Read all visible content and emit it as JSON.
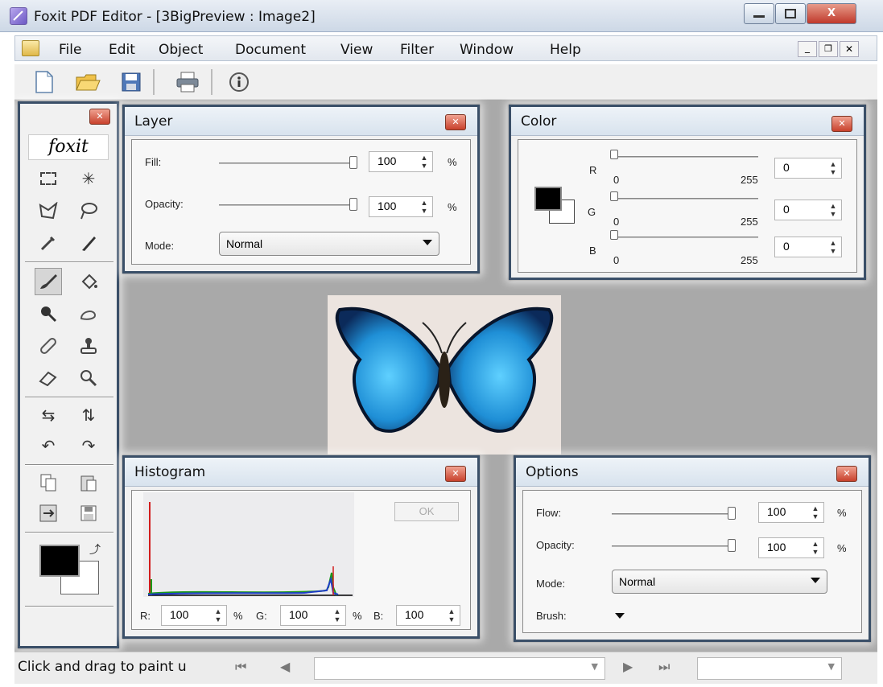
{
  "window": {
    "title": "Foxit PDF Editor - [3BigPreview : Image2]",
    "close_label": "X"
  },
  "menu": {
    "items": [
      "File",
      "Edit",
      "Object",
      "Document",
      "View",
      "Filter",
      "Window",
      "Help"
    ]
  },
  "toolbox": {
    "brand": "foxit"
  },
  "layer": {
    "title": "Layer",
    "fill_label": "Fill:",
    "fill_value": "100",
    "fill_pct": 1.0,
    "opacity_label": "Opacity:",
    "opacity_value": "100",
    "opacity_pct": 1.0,
    "mode_label": "Mode:",
    "mode_value": "Normal",
    "unit": "%"
  },
  "color": {
    "title": "Color",
    "channels": [
      {
        "label": "R",
        "min": "0",
        "max": "255",
        "value": "0"
      },
      {
        "label": "G",
        "min": "0",
        "max": "255",
        "value": "0"
      },
      {
        "label": "B",
        "min": "0",
        "max": "255",
        "value": "0"
      }
    ],
    "foreground": "#000000",
    "background": "#ffffff"
  },
  "histogram": {
    "title": "Histogram",
    "ok_label": "OK",
    "r_label": "R:",
    "r_value": "100",
    "g_label": "G:",
    "g_value": "100",
    "b_label": "B:",
    "b_value": "100",
    "unit": "%"
  },
  "options": {
    "title": "Options",
    "flow_label": "Flow:",
    "flow_value": "100",
    "flow_pct": 1.0,
    "opacity_label": "Opacity:",
    "opacity_value": "100",
    "opacity_pct": 1.0,
    "mode_label": "Mode:",
    "mode_value": "Normal",
    "brush_label": "Brush:",
    "unit": "%"
  },
  "status": {
    "text": "Click and drag to paint u"
  },
  "colors": {
    "accent": "#3a4f68",
    "workspace": "#a9a9a9",
    "close": "#c8412c"
  }
}
